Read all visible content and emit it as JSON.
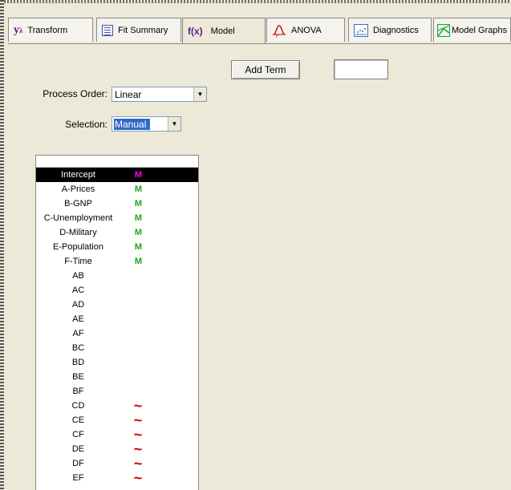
{
  "tabs": [
    {
      "label": "Transform",
      "icon": "y-lambda-icon"
    },
    {
      "label": "Fit Summary",
      "icon": "list-icon"
    },
    {
      "label": "Model",
      "icon": "fx-icon",
      "prefix": "f(x)",
      "active": true
    },
    {
      "label": "ANOVA",
      "icon": "anova-icon"
    },
    {
      "label": "Diagnostics",
      "icon": "diagnostics-icon"
    },
    {
      "label": "Model Graphs",
      "icon": "model-graphs-icon"
    }
  ],
  "add_term": {
    "label": "Add Term",
    "input_value": ""
  },
  "process_order": {
    "label": "Process Order:",
    "value": "Linear"
  },
  "selection": {
    "label": "Selection:",
    "value": "Manual"
  },
  "terms": [
    {
      "name": "Intercept",
      "marker": "M",
      "marker_color": "#ff00ff",
      "selected": true
    },
    {
      "name": "A-Prices",
      "marker": "M",
      "marker_color": "#1fa31f"
    },
    {
      "name": "B-GNP",
      "marker": "M",
      "marker_color": "#1fa31f"
    },
    {
      "name": "C-Unemployment",
      "marker": "M",
      "marker_color": "#1fa31f"
    },
    {
      "name": "D-Military",
      "marker": "M",
      "marker_color": "#1fa31f"
    },
    {
      "name": "E-Population",
      "marker": "M",
      "marker_color": "#1fa31f"
    },
    {
      "name": "F-Time",
      "marker": "M",
      "marker_color": "#1fa31f"
    },
    {
      "name": "AB",
      "marker": ""
    },
    {
      "name": "AC",
      "marker": ""
    },
    {
      "name": "AD",
      "marker": ""
    },
    {
      "name": "AE",
      "marker": ""
    },
    {
      "name": "AF",
      "marker": ""
    },
    {
      "name": "BC",
      "marker": ""
    },
    {
      "name": "BD",
      "marker": ""
    },
    {
      "name": "BE",
      "marker": ""
    },
    {
      "name": "BF",
      "marker": ""
    },
    {
      "name": "CD",
      "marker": "~",
      "marker_color": "#c80000"
    },
    {
      "name": "CE",
      "marker": "~",
      "marker_color": "#c80000"
    },
    {
      "name": "CF",
      "marker": "~",
      "marker_color": "#c80000"
    },
    {
      "name": "DE",
      "marker": "~",
      "marker_color": "#c80000"
    },
    {
      "name": "DF",
      "marker": "~",
      "marker_color": "#c80000"
    },
    {
      "name": "EF",
      "marker": "~",
      "marker_color": "#c80000"
    }
  ]
}
